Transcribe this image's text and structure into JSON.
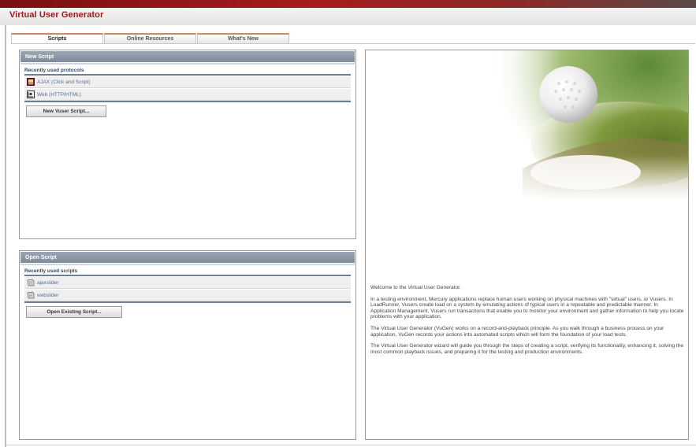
{
  "app": {
    "title": "Virtual User Generator"
  },
  "tabs": [
    {
      "label": "Scripts",
      "active": true
    },
    {
      "label": "Online Resources",
      "active": false
    },
    {
      "label": "What's New",
      "active": false
    }
  ],
  "new_script": {
    "header": "New Script",
    "section_label": "Recently used protocols",
    "items": [
      {
        "label": "AJAX (Click and Script)",
        "icon": "ajax-protocol-icon"
      },
      {
        "label": "Web (HTTP/HTML)",
        "icon": "web-protocol-icon"
      }
    ],
    "button_label": "New Vuser Script..."
  },
  "open_script": {
    "header": "Open Script",
    "section_label": "Recently used scripts",
    "items": [
      {
        "label": "ajaxslider",
        "icon": "script-file-icon"
      },
      {
        "label": "webslider",
        "icon": "script-file-icon"
      }
    ],
    "button_label": "Open Existing Script..."
  },
  "welcome": {
    "paragraphs": [
      "Welcome to the Virtual User Generator.",
      "In a testing environment, Mercury applications replace human users working on physical machines with \"virtual\" users, or Vusers. In LoadRunner, Vusers create load on a system by emulating actions of typical users in a repeatable and predictable manner. In Application Management, Vusers run transactions that enable you to monitor your environment and gather information to help you locate problems with your application.",
      "The Virtual User Generator (VuGen) works on a record-and-playback principle. As you walk through a business process on your application, VuGen records your actions into automated scripts which will form the foundation of your load tests.",
      "The Virtual User Generator wizard will guide you through the steps of creating a script, verifying its functionality, enhancing it, solving the most common playback issues, and preparing it for the testing and production environments."
    ]
  },
  "colors": {
    "brand_red": "#a0161a",
    "panel_header": "#8996a6",
    "link_blue": "#5a6f8e"
  }
}
